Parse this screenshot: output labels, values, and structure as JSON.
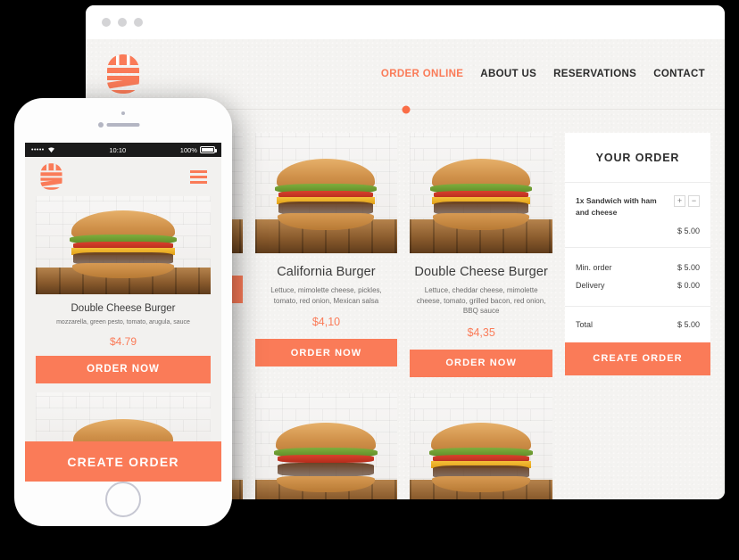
{
  "window": {
    "dots": [
      "close",
      "minimize",
      "maximize"
    ]
  },
  "site": {
    "logo": "burger-logo",
    "nav": [
      {
        "label": "ORDER ONLINE",
        "active": true
      },
      {
        "label": "ABOUT US",
        "active": false
      },
      {
        "label": "RESERVATIONS",
        "active": false
      },
      {
        "label": "CONTACT",
        "active": false
      }
    ],
    "menu_cards": [
      {
        "title": "",
        "description": "",
        "price": "",
        "cta": "ORDER NOW"
      },
      {
        "title": "California Burger",
        "description": "Lettuce, mimolette cheese, pickles, tomato, red onion, Mexican salsa",
        "price": "$4,10",
        "cta": "ORDER NOW"
      },
      {
        "title": "Double Cheese Burger",
        "description": "Lettuce, cheddar cheese, mimolette cheese, tomato, grilled bacon, red onion, BBQ sauce",
        "price": "$4,35",
        "cta": "ORDER NOW"
      }
    ],
    "order_panel": {
      "heading": "YOUR ORDER",
      "item": {
        "name": "1x Sandwich with ham and cheese",
        "price": "$ 5.00",
        "increase": "+",
        "decrease": "−"
      },
      "rows": [
        {
          "label": "Min. order",
          "value": "$ 5.00"
        },
        {
          "label": "Delivery",
          "value": "$ 0.00"
        }
      ],
      "total": {
        "label": "Total",
        "value": "$ 5.00"
      },
      "cta": "CREATE ORDER"
    }
  },
  "phone": {
    "statusbar": {
      "signal": "•••••",
      "wifi": "wifi-icon",
      "time": "10:10",
      "battery_percent": "100%"
    },
    "app_header": {
      "logo": "burger-logo",
      "menu": "hamburger-menu-icon"
    },
    "featured": {
      "title": "Double Cheese Burger",
      "description": "mozzarella, green pesto, tomato, arugula, sauce",
      "price": "$4.79",
      "cta": "ORDER NOW"
    },
    "cta": "CREATE ORDER"
  },
  "colors": {
    "accent": "#fa7b58",
    "accent_dot": "#fa6d46",
    "page_bg": "#f4f3f1",
    "panel_bg": "#ffffff",
    "text": "#3b3b3b",
    "canvas": "#000000"
  }
}
